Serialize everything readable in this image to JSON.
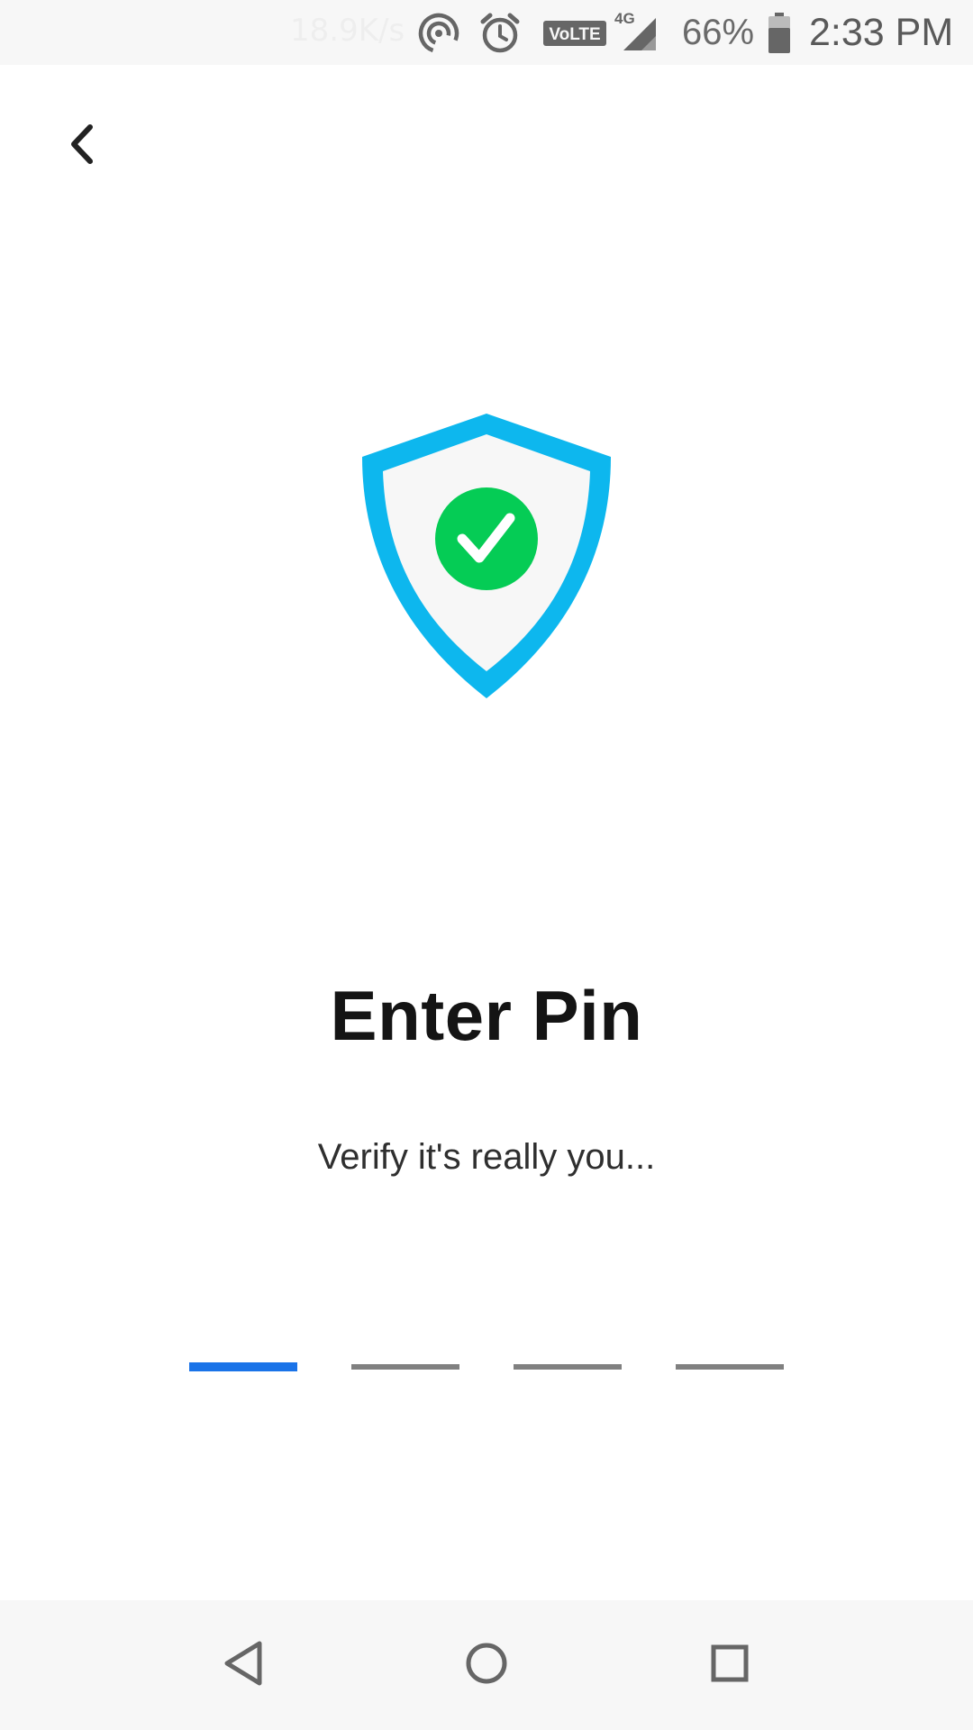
{
  "status_bar": {
    "net_speed": "18.9K/s",
    "network_label": "VoLTE",
    "network_type": "4G",
    "battery_percent": "66%",
    "time": "2:33 PM",
    "icons": [
      "hotspot-icon",
      "alarm-icon",
      "volte-icon",
      "signal-icon",
      "battery-icon"
    ]
  },
  "header": {
    "back_icon": "chevron-left-icon"
  },
  "illustration": {
    "icon": "shield-check-icon",
    "shield_color": "#0db7ee",
    "check_color": "#05cc55"
  },
  "main": {
    "title": "Enter Pin",
    "subtitle": "Verify it's really you...",
    "pin_length": 4,
    "active_slot": 1,
    "active_color": "#1a73e8"
  },
  "nav_bar": {
    "items": [
      "back-triangle-icon",
      "home-circle-icon",
      "recents-square-icon"
    ]
  }
}
